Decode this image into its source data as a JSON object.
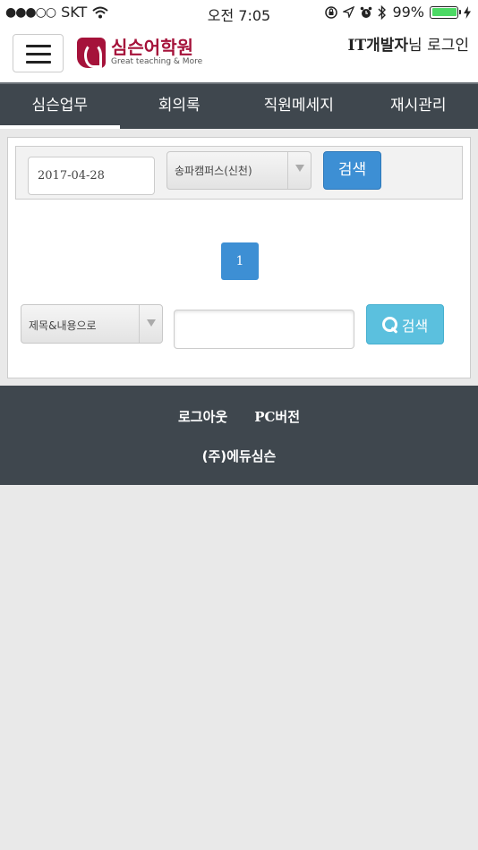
{
  "status_bar": {
    "signal": "●●●○○",
    "carrier": "SKT",
    "time": "오전 7:05",
    "battery": "99%"
  },
  "header": {
    "logo_title": "심슨어학원",
    "logo_subtitle": "Great teaching & More",
    "user_name": "IT개발자",
    "login_suffix": "님 로그인"
  },
  "nav": {
    "tabs": [
      {
        "label": "심슨업무",
        "active": true
      },
      {
        "label": "회의록",
        "active": false
      },
      {
        "label": "직원메세지",
        "active": false
      },
      {
        "label": "재시관리",
        "active": false
      }
    ]
  },
  "search": {
    "date_value": "2017-04-28",
    "campus_selected": "송파캠퍼스(신천)",
    "search_label": "검색"
  },
  "pagination": {
    "current_page": "1"
  },
  "filter": {
    "field_selected": "제목&내용으로",
    "keyword_value": "",
    "search_label": "검색"
  },
  "footer": {
    "logout": "로그아웃",
    "pc_version": "PC버전",
    "company": "(주)에듀심슨"
  },
  "colors": {
    "brand": "#a5123a",
    "nav_bg": "#3f474e",
    "primary_button": "#3d8fd4",
    "info_button": "#5bc0de"
  }
}
